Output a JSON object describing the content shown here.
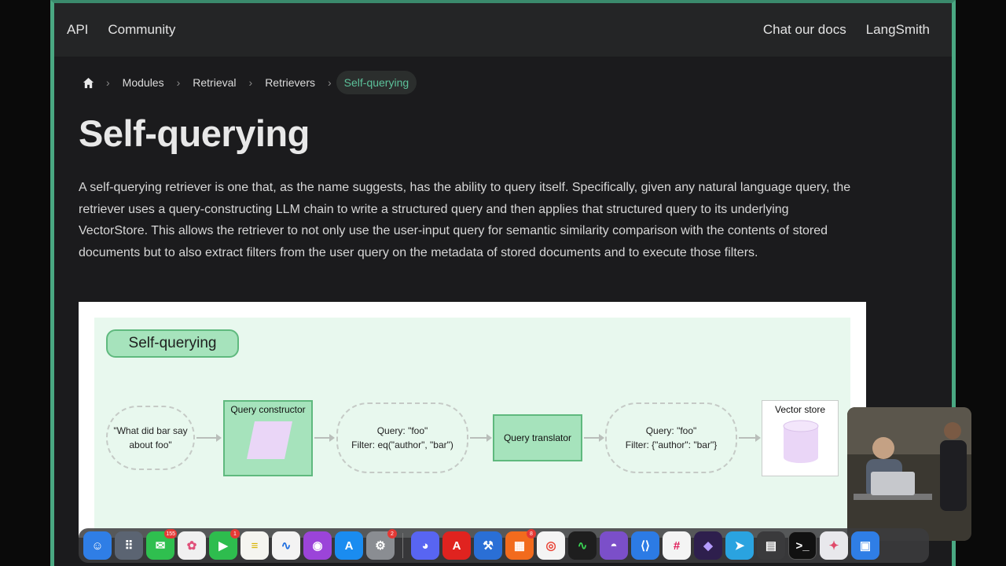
{
  "nav": {
    "left": [
      "API",
      "Community"
    ],
    "right": [
      "Chat our docs",
      "LangSmith"
    ]
  },
  "breadcrumb": {
    "items": [
      "Modules",
      "Retrieval",
      "Retrievers"
    ],
    "active": "Self-querying"
  },
  "page": {
    "title": "Self-querying",
    "body": "A self-querying retriever is one that, as the name suggests, has the ability to query itself. Specifically, given any natural language query, the retriever uses a query-constructing LLM chain to write a structured query and then applies that structured query to its underlying VectorStore. This allows the retriever to not only use the user-input query for semantic similarity comparison with the contents of stored documents but to also extract filters from the user query on the metadata of stored documents and to execute those filters."
  },
  "diagram": {
    "label": "Self-querying",
    "input": "\"What did bar say about foo\"",
    "constructor": "Query constructor",
    "query1_line1": "Query: \"foo\"",
    "query1_line2": "Filter: eq(\"author\", \"bar\")",
    "translator": "Query translator",
    "query2_line1": "Query: \"foo\"",
    "query2_line2": "Filter: {\"author\": \"bar\"}",
    "store": "Vector store"
  },
  "dock": {
    "badges": {
      "messages": "155",
      "facetime": "1",
      "settings": "2",
      "notifications": "8"
    }
  },
  "colors": {
    "accent": "#5cc19a",
    "frame": "#4aa882",
    "diagram_green": "#a6e3bc"
  }
}
